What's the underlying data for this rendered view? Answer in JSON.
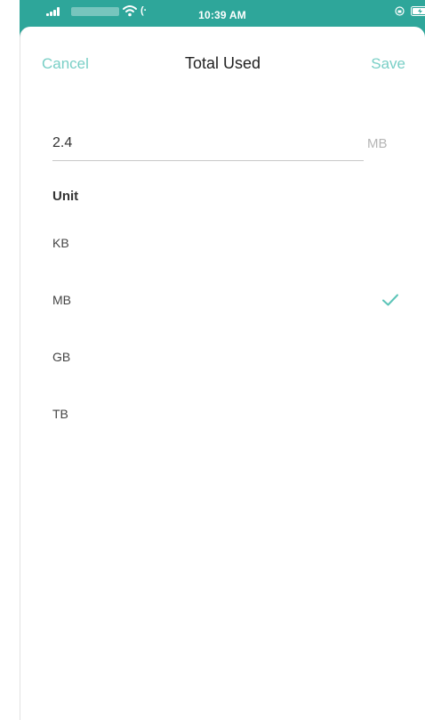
{
  "status_bar": {
    "time": "10:39 AM",
    "activity_glyph": "(·",
    "colors": {
      "background": "#2ea69a",
      "foreground": "#ffffff"
    },
    "icons": [
      "signal-icon",
      "wifi-icon",
      "lock-rotation-icon",
      "battery-charging-icon"
    ]
  },
  "nav": {
    "cancel_label": "Cancel",
    "title": "Total Used",
    "save_label": "Save",
    "accent_color": "#79cfc6"
  },
  "value_input": {
    "value": "2.4",
    "unit_suffix": "MB"
  },
  "unit_section": {
    "label": "Unit",
    "options": [
      {
        "label": "KB",
        "selected": false
      },
      {
        "label": "MB",
        "selected": true
      },
      {
        "label": "GB",
        "selected": false
      },
      {
        "label": "TB",
        "selected": false
      }
    ],
    "selected_icon": "checkmark-icon"
  }
}
